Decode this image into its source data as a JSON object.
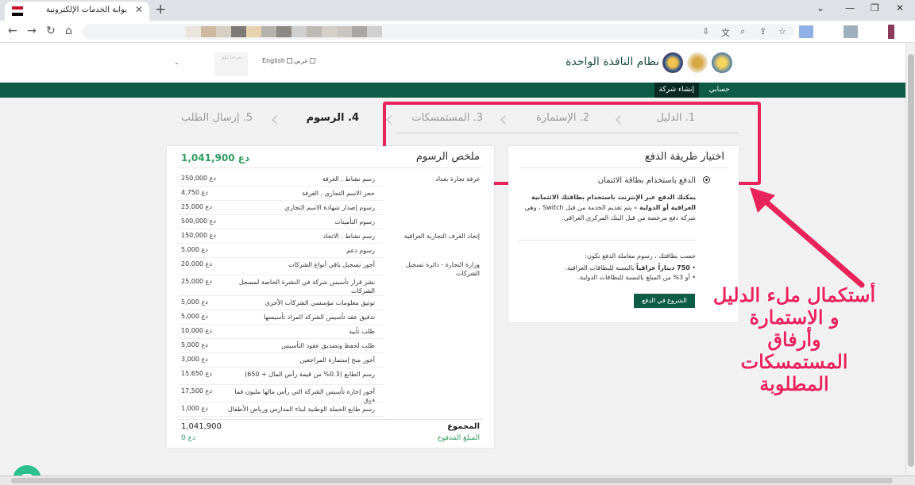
{
  "browser": {
    "tab_title": "بوابة الخدمات الإلكترونية",
    "tab_close": "✕",
    "new_tab": "+",
    "flag_colors": [
      "#ce1126",
      "#ffffff",
      "#000000"
    ],
    "blurred_url_colors": [
      "#e9e4dc",
      "#cdb9a0",
      "#d8cfc4",
      "#7d7a78",
      "#e7d2ae",
      "#b5b1ac",
      "#8c8884",
      "#cfcfcf",
      "#bdbab5",
      "#d6cfc8",
      "#cbc6c2",
      "#a9a6a3",
      "#d2d0ce"
    ]
  },
  "header": {
    "site_title": "نظام النافذة الواحدة",
    "lang_arabic": "عربي",
    "lang_english": "English",
    "welcome": "مرحبا بكم"
  },
  "navbar": {
    "items": [
      {
        "label": "حسابي"
      },
      {
        "label": "إنشاء شركة"
      }
    ]
  },
  "steps": [
    {
      "label": "1. الدليل"
    },
    {
      "label": "2. الإستمارة"
    },
    {
      "label": "3. المستمسكات"
    },
    {
      "label": "4. الرسوم"
    },
    {
      "label": "5. إرسال الطلب"
    }
  ],
  "fees": {
    "title": "ملخص الرسوم",
    "total_top": "1,041,900 دع",
    "rows": [
      {
        "group": "غرفة تجارة بغداد",
        "desc": "رسم نشاط . الغرفة",
        "amount": "250,000 دع"
      },
      {
        "group": "",
        "desc": "حجز الاسم التجاري . الغرفة",
        "amount": "4,750 دع"
      },
      {
        "group": "",
        "desc": "رسوم إصدار شهادة الاسم التجاري",
        "amount": "25,000 دع"
      },
      {
        "group": "",
        "desc": "رسوم التأمينات",
        "amount": "500,000 دع"
      },
      {
        "group": "إتحاد الغرف التجارية العراقية",
        "desc": "رسم نشاط . الاتحاد",
        "amount": "150,000 دع"
      },
      {
        "group": "",
        "desc": "رسوم دعم",
        "amount": "5,000 دع"
      },
      {
        "group": "وزارة التجارة - دائرة تسجيل الشركات",
        "desc": "أجور تسجيل باقي أنواع الشركات",
        "amount": "20,000 دع"
      },
      {
        "group": "",
        "desc": "نشر قرار تأسيس شركة في النشرة الخاصة لمسجل الشركات",
        "amount": "25,000 دع"
      },
      {
        "group": "",
        "desc": "توثيق معلومات مؤسسي الشركات الأخرى",
        "amount": "5,000 دع"
      },
      {
        "group": "",
        "desc": "تدقيق عقد تأسيس الشركة المراد تأسيسها",
        "amount": "5,000 دع"
      },
      {
        "group": "",
        "desc": "طلب تأييد",
        "amount": "10,000 دع"
      },
      {
        "group": "",
        "desc": "طلب لحفظ وتصديق عقود التأسيس",
        "amount": "5,000 دع"
      },
      {
        "group": "",
        "desc": "أجور منح إستمارة المراجعين",
        "amount": "3,000 دع"
      },
      {
        "group": "",
        "desc": "رسم الطابع (0.3% من قيمة رأس المال + 650)",
        "amount": "15,650 دع"
      },
      {
        "group": "",
        "desc": "أجور إجازة تأسيس الشركة التي رأس مالها مليون فما فوق",
        "amount": "17,500 دع"
      },
      {
        "group": "",
        "desc": "رسم طابع الحملة الوطنية لبناء المدارس ورياض الأطفال",
        "amount": "1,000 دع"
      }
    ],
    "sum_label": "المجموع",
    "sum_value": "1,041,900",
    "paid_label": "المبلغ المدفوع",
    "paid_value": "0 دع"
  },
  "payment": {
    "title": "اختيار طريقة الدفع",
    "option": "الدفع باستخدام بطاقة الائتمان",
    "desc_bold": "يمكنك الدفع عبر الإنترنت باستخدام بطاقتك الائتمانية العراقية أو الدولية –",
    "desc_rest": " يتم تقديم الخدمة من قبل Switch ، وهي شركة دفع مرخصة من قبل البنك المركزي العراقي.",
    "fee_intro": "حسب بطاقتك ، رسوم معاملة الدفع تكون:",
    "bullet1_bold": "750 ديناراً عراقياً",
    "bullet1_rest": " بالنسبة للبطاقات العراقية.",
    "bullet2": "أو 3% من المبلغ بالنسبة للبطاقات الدولية.",
    "start_button": "الشروع في الدفع"
  },
  "annotation": {
    "line1": "أستكمال ملء الدليل",
    "line2": "و الاستمارة",
    "line3": "وأرفاق المستمسكات",
    "line4": "المطلوبة"
  },
  "colors": {
    "brand_green": "#0e5c47",
    "accent_pink": "#e8245d",
    "money_green": "#2e9b5e"
  }
}
